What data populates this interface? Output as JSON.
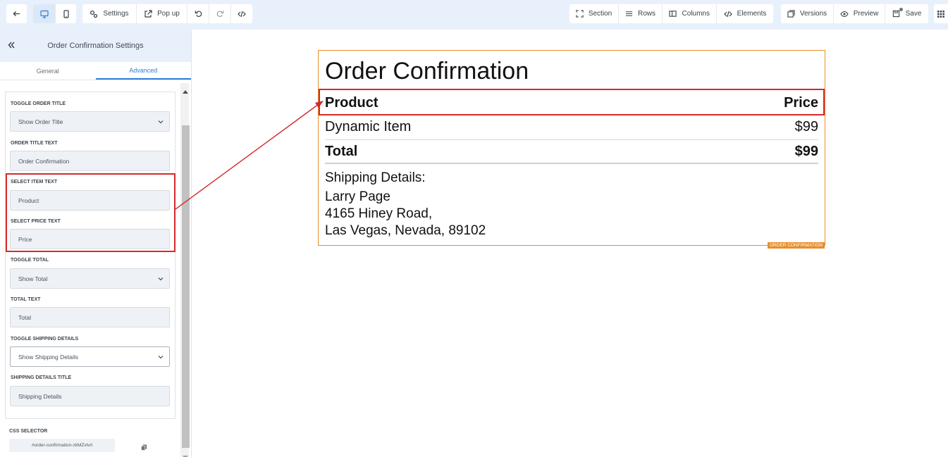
{
  "toolbar": {
    "settings": "Settings",
    "popup": "Pop up",
    "section": "Section",
    "rows": "Rows",
    "columns": "Columns",
    "elements": "Elements",
    "versions": "Versions",
    "preview": "Preview",
    "save": "Save"
  },
  "sidebar": {
    "title": "Order Confirmation Settings",
    "tabs": [
      "General",
      "Advanced"
    ],
    "fields": {
      "toggle_order_title": {
        "label": "TOGGLE ORDER TITLE",
        "value": "Show Order Title"
      },
      "order_title_text": {
        "label": "ORDER TITLE TEXT",
        "value": "Order Confirmation"
      },
      "select_item_text": {
        "label": "SELECT ITEM TEXT",
        "value": "Product"
      },
      "select_price_text": {
        "label": "SELECT PRICE TEXT",
        "value": "Price"
      },
      "toggle_total": {
        "label": "TOGGLE TOTAL",
        "value": "Show Total"
      },
      "total_text": {
        "label": "TOTAL TEXT",
        "value": "Total"
      },
      "toggle_shipping": {
        "label": "TOGGLE SHIPPING DETAILS",
        "value": "Show Shipping Details"
      },
      "shipping_title": {
        "label": "SHIPPING DETAILS TITLE",
        "value": "Shipping Details"
      }
    },
    "css_selector": {
      "label": "CSS SELECTOR",
      "value": "#order-confirmation-zkMZvtvrl"
    }
  },
  "widget": {
    "title": "Order Confirmation",
    "header_product": "Product",
    "header_price": "Price",
    "item_name": "Dynamic Item",
    "item_price": "$99",
    "total_label": "Total",
    "total_value": "$99",
    "shipping_heading": "Shipping Details:",
    "shipping_name": "Larry Page",
    "shipping_street": "4165 Hiney Road,",
    "shipping_city": "Las Vegas, Nevada, 89102",
    "tag": "ORDER CONFIRMATION"
  },
  "colors": {
    "highlight": "#d42a2a",
    "widget_border": "#e88e2a",
    "accent": "#2f7fd6",
    "topbar_bg": "#e8f1fb"
  }
}
